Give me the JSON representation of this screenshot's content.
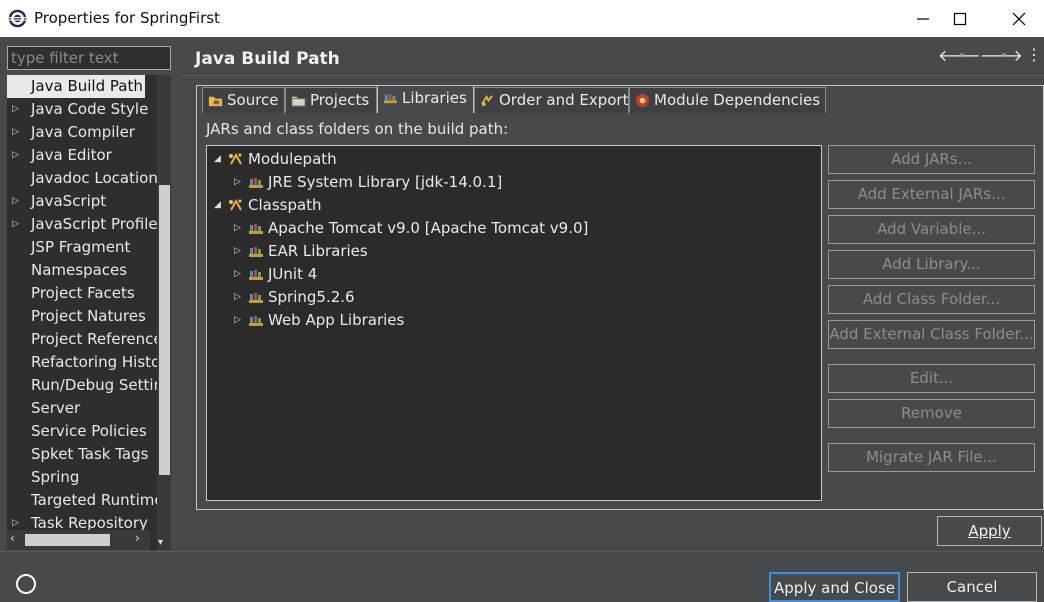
{
  "window": {
    "title": "Properties for SpringFirst",
    "minimize_glyph": "—",
    "maximize_glyph": "☐",
    "close_glyph": "✕"
  },
  "left": {
    "filter_placeholder": "type filter text",
    "items": [
      {
        "label": "Java Build Path",
        "expandable": false,
        "selected": true
      },
      {
        "label": "Java Code Style",
        "expandable": true
      },
      {
        "label": "Java Compiler",
        "expandable": true
      },
      {
        "label": "Java Editor",
        "expandable": true
      },
      {
        "label": "Javadoc Location",
        "expandable": false
      },
      {
        "label": "JavaScript",
        "expandable": true
      },
      {
        "label": "JavaScript Profile",
        "expandable": true
      },
      {
        "label": "JSP Fragment",
        "expandable": false
      },
      {
        "label": "Namespaces",
        "expandable": false
      },
      {
        "label": "Project Facets",
        "expandable": false
      },
      {
        "label": "Project Natures",
        "expandable": false
      },
      {
        "label": "Project References",
        "expandable": false
      },
      {
        "label": "Refactoring History",
        "expandable": false
      },
      {
        "label": "Run/Debug Settings",
        "expandable": false
      },
      {
        "label": "Server",
        "expandable": false
      },
      {
        "label": "Service Policies",
        "expandable": false
      },
      {
        "label": "Spket Task Tags",
        "expandable": false
      },
      {
        "label": "Spring",
        "expandable": false
      },
      {
        "label": "Targeted Runtimes",
        "expandable": false
      },
      {
        "label": "Task Repository",
        "expandable": true
      }
    ]
  },
  "main": {
    "title": "Java Build Path",
    "tabs": [
      {
        "label": "Source",
        "icon": "source-folder-icon"
      },
      {
        "label": "Projects",
        "icon": "projects-icon"
      },
      {
        "label": "Libraries",
        "icon": "libraries-icon",
        "active": true
      },
      {
        "label": "Order and Export",
        "icon": "order-export-icon"
      },
      {
        "label": "Module Dependencies",
        "icon": "module-dependencies-icon"
      }
    ],
    "section_label": "JARs and class folders on the build path:",
    "tree": [
      {
        "label": "Modulepath",
        "level": 0,
        "expanded": true,
        "icon": "path-container-icon"
      },
      {
        "label": "JRE System Library [jdk-14.0.1]",
        "level": 1,
        "expanded": false,
        "icon": "library-icon"
      },
      {
        "label": "Classpath",
        "level": 0,
        "expanded": true,
        "icon": "path-container-icon"
      },
      {
        "label": "Apache Tomcat v9.0 [Apache Tomcat v9.0]",
        "level": 1,
        "expanded": false,
        "icon": "library-icon"
      },
      {
        "label": "EAR Libraries",
        "level": 1,
        "expanded": false,
        "icon": "library-icon"
      },
      {
        "label": "JUnit 4",
        "level": 1,
        "expanded": false,
        "icon": "library-icon"
      },
      {
        "label": "Spring5.2.6",
        "level": 1,
        "expanded": false,
        "icon": "library-icon"
      },
      {
        "label": "Web App Libraries",
        "level": 1,
        "expanded": false,
        "icon": "library-icon"
      }
    ],
    "buttons": [
      {
        "label": "Add JARs...",
        "enabled": false
      },
      {
        "label": "Add External JARs...",
        "enabled": false
      },
      {
        "label": "Add Variable...",
        "enabled": false
      },
      {
        "label": "Add Library...",
        "enabled": false
      },
      {
        "label": "Add Class Folder...",
        "enabled": false
      },
      {
        "label": "Add External Class Folder...",
        "enabled": false
      },
      {
        "label": "Edit...",
        "enabled": false
      },
      {
        "label": "Remove",
        "enabled": false
      },
      {
        "label": "Migrate JAR File...",
        "enabled": false
      }
    ],
    "apply_label": "Apply"
  },
  "footer": {
    "apply_close_label": "Apply and Close",
    "cancel_label": "Cancel"
  },
  "colors": {
    "background": "#474a4d",
    "tree_background": "#2b2b2b",
    "selection": "#e9e9e9",
    "primary_border": "#3f8fdc"
  }
}
